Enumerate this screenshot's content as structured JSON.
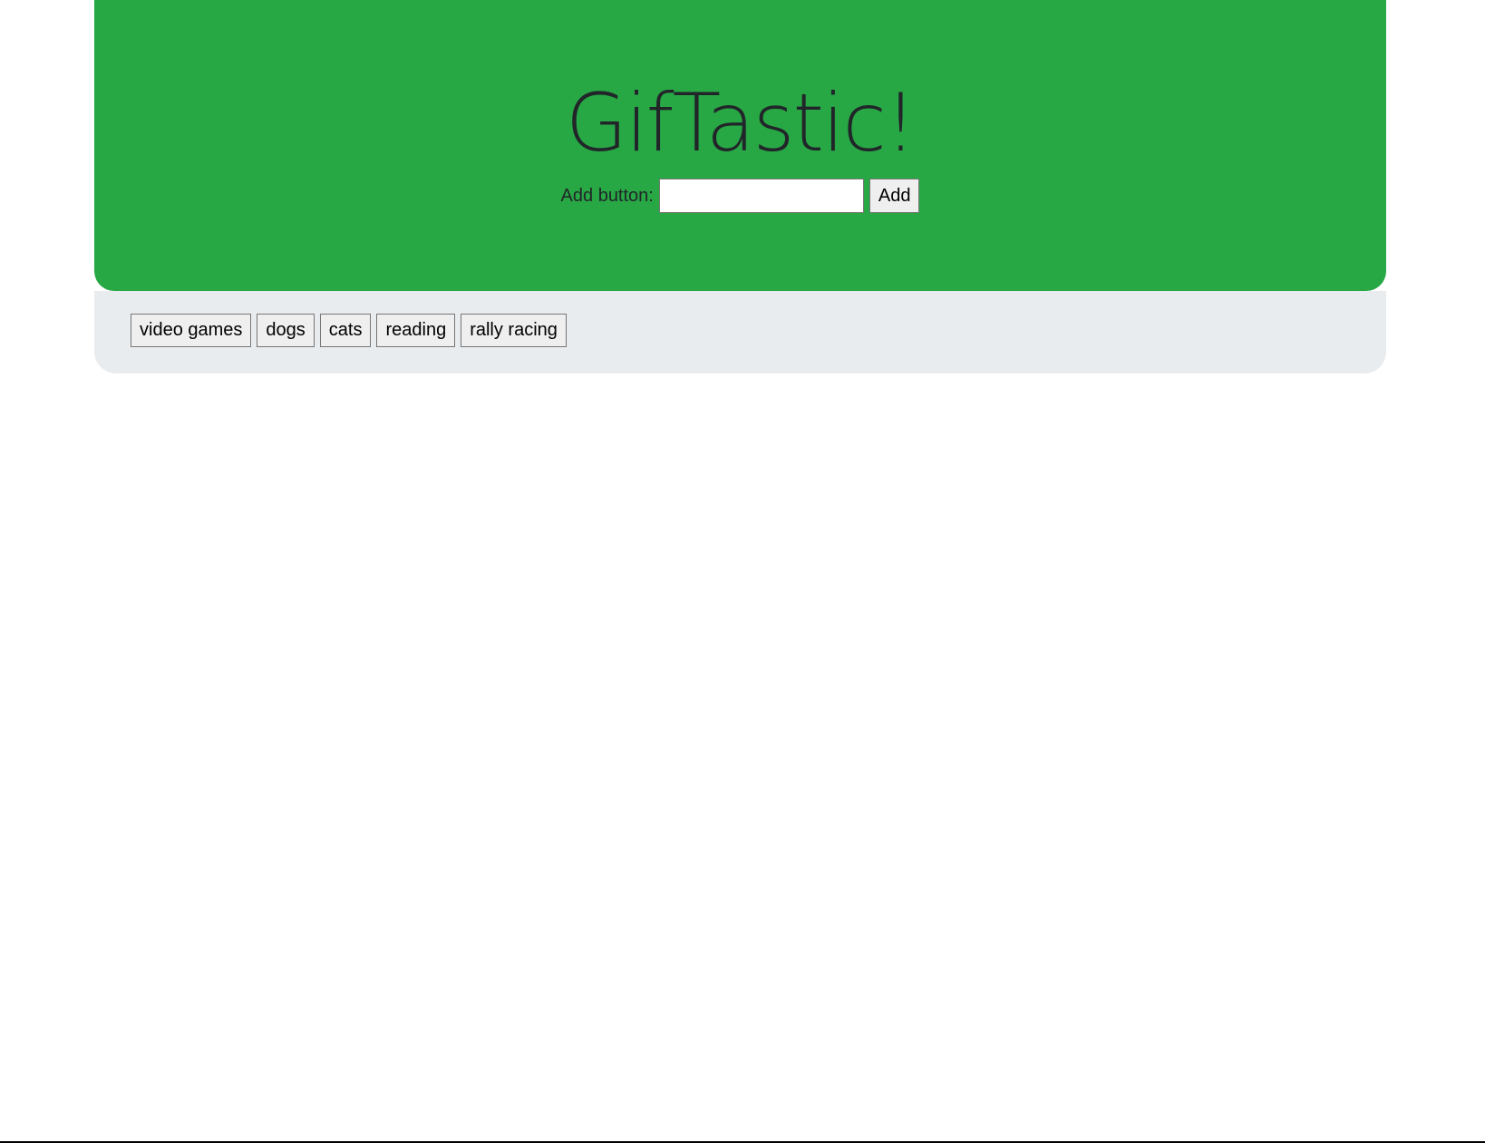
{
  "header": {
    "title": "GifTastic!",
    "add_label": "Add button:",
    "add_input_value": "",
    "add_button_label": "Add"
  },
  "topics": [
    {
      "label": "video games"
    },
    {
      "label": "dogs"
    },
    {
      "label": "cats"
    },
    {
      "label": "reading"
    },
    {
      "label": "rally racing"
    }
  ],
  "colors": {
    "header_bg": "#28a745",
    "button_bar_bg": "#e9ecef"
  }
}
